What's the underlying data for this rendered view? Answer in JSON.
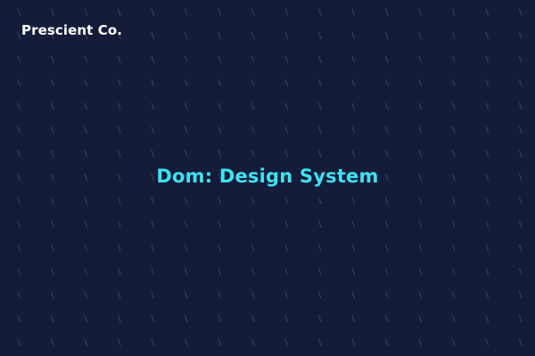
{
  "brand": {
    "name": "Prescient Co."
  },
  "hero": {
    "title": "Dom: Design System"
  },
  "theme": {
    "background": "#141c3a",
    "accent": "#3ce3f0",
    "text": "#ffffff",
    "pattern_stroke": "#3a4466"
  },
  "decoration": {
    "pattern_icon": "backslash-dash-pattern"
  }
}
